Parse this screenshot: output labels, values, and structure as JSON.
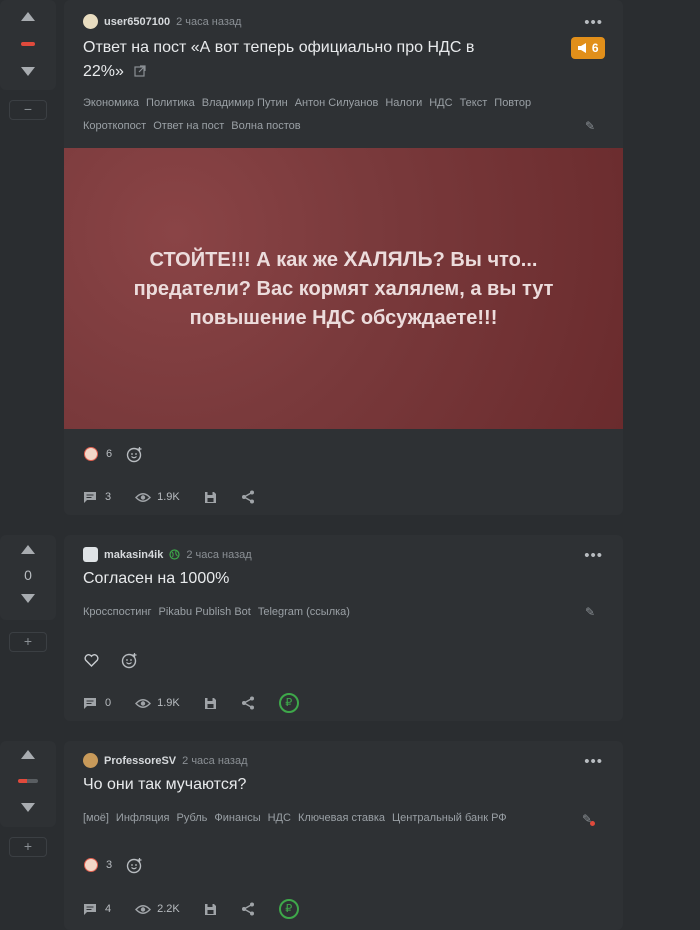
{
  "posts": [
    {
      "score": "",
      "author": "user6507100",
      "time": "2 часа назад",
      "title_line1": "Ответ на пост «А вот теперь официально про НДС в",
      "title_line2": "22%»",
      "badge": "6",
      "tags_line1": [
        "Экономика",
        "Политика",
        "Владимир Путин",
        "Антон Силуанов",
        "Налоги",
        "НДС",
        "Текст",
        "Повтор"
      ],
      "tags_line2": [
        "Короткопост",
        "Ответ на пост",
        "Волна постов"
      ],
      "image_text_parts": [
        "СТОЙТЕ!!! А как же ",
        "ХАЛЯЛЬ",
        "? Вы что... предатели? Вас кормят халялем, а вы тут повышение НДС обсуждаете!!!"
      ],
      "reaction_count": "6",
      "comments": "3",
      "views": "1.9K"
    },
    {
      "score": "0",
      "author": "makasin4ik",
      "time": "2 часа назад",
      "title": "Согласен на 1000%",
      "tags": [
        "Кросспостинг",
        "Pikabu Publish Bot",
        "Telegram (ссылка)"
      ],
      "comments": "0",
      "views": "1.9K"
    },
    {
      "score": "",
      "author": "ProfessoreSV",
      "time": "2 часа назад",
      "title": "Чо они так мучаются?",
      "tags": [
        "[моё]",
        "Инфляция",
        "Рубль",
        "Финансы",
        "НДС",
        "Ключевая ставка",
        "Центральный банк РФ"
      ],
      "reaction_count": "3",
      "comments": "4",
      "views": "2.2K"
    }
  ],
  "icons": {
    "minus": "−",
    "plus": "+",
    "dots": "•••",
    "ruble": "₽"
  },
  "colors": {
    "background": "#2a2d30",
    "card": "#2e3134",
    "accent_orange": "#e18f1a",
    "vote_red": "#e04a3c",
    "image_bg": "#7a3a3c",
    "ruble_green": "#3ea84a"
  }
}
